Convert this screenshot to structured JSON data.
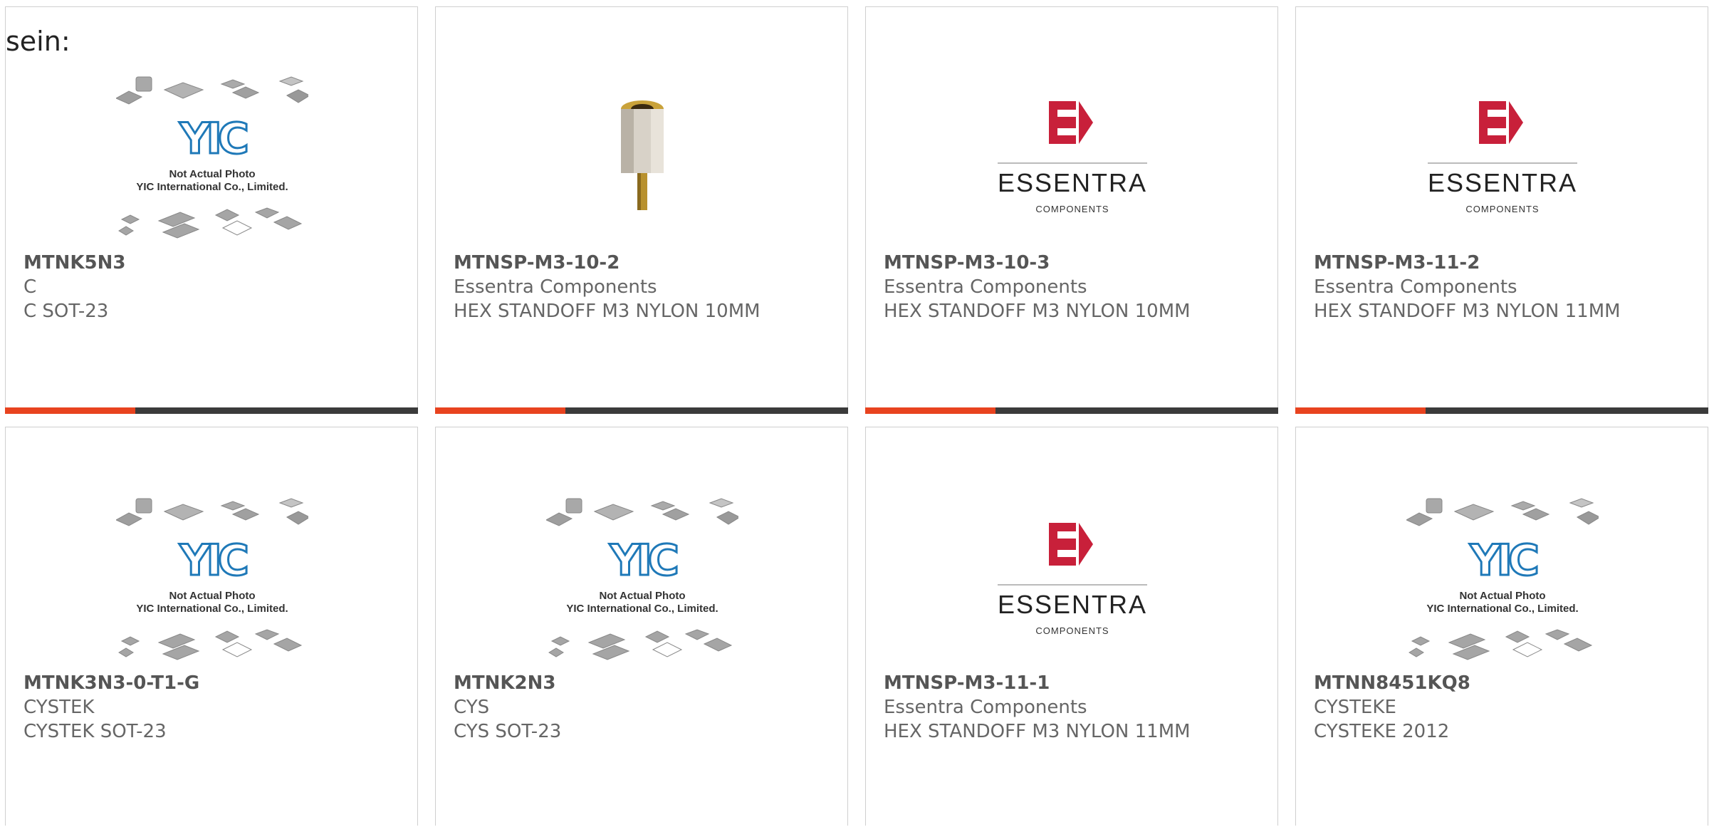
{
  "page": {
    "label": "sein:"
  },
  "products": [
    {
      "part": "MTNK5N3",
      "manufacturer": "C",
      "description": "C SOT-23",
      "image": "yic-placeholder"
    },
    {
      "part": "MTNSP-M3-10-2",
      "manufacturer": "Essentra Components",
      "description": "HEX STANDOFF M3 NYLON 10MM",
      "image": "hex-standoff-photo"
    },
    {
      "part": "MTNSP-M3-10-3",
      "manufacturer": "Essentra Components",
      "description": "HEX STANDOFF M3 NYLON 10MM",
      "image": "essentra-logo"
    },
    {
      "part": "MTNSP-M3-11-2",
      "manufacturer": "Essentra Components",
      "description": "HEX STANDOFF M3 NYLON 11MM",
      "image": "essentra-logo"
    },
    {
      "part": "MTNK3N3-0-T1-G",
      "manufacturer": "CYSTEK",
      "description": "CYSTEK SOT-23",
      "image": "yic-placeholder"
    },
    {
      "part": "MTNK2N3",
      "manufacturer": "CYS",
      "description": "CYS SOT-23",
      "image": "yic-placeholder"
    },
    {
      "part": "MTNSP-M3-11-1",
      "manufacturer": "Essentra Components",
      "description": "HEX STANDOFF M3 NYLON 11MM",
      "image": "essentra-logo"
    },
    {
      "part": "MTNN8451KQ8",
      "manufacturer": "CYSTEKE",
      "description": "CYSTEKE 2012",
      "image": "yic-placeholder"
    }
  ],
  "placeholder": {
    "logo": "YIC",
    "caption_line1": "Not Actual Photo",
    "caption_line2": "YIC International Co., Limited."
  },
  "essentra": {
    "brand": "ESSENTRA",
    "sub": "COMPONENTS"
  },
  "colors": {
    "accent": "#e8431f",
    "bar": "#3b3b3b",
    "essentra_red": "#c8203a"
  }
}
